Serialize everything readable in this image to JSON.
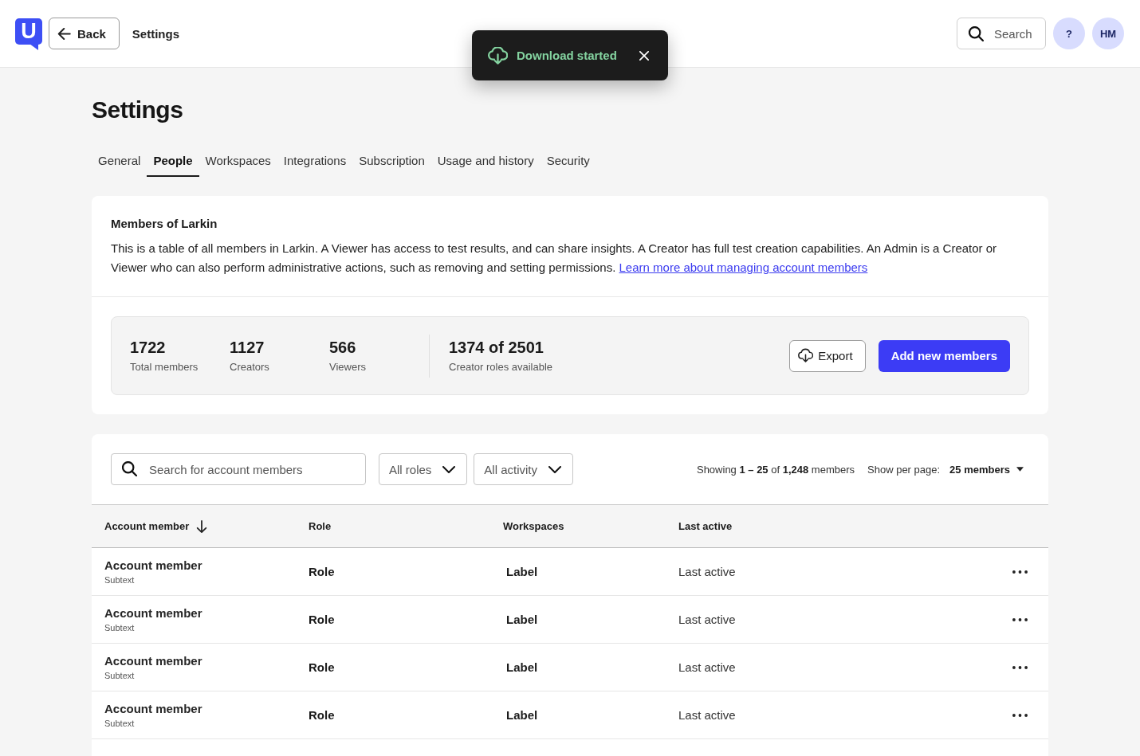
{
  "header": {
    "logo": "U",
    "back": "Back",
    "title": "Settings",
    "search": "Search",
    "help": "?",
    "avatar": "HM"
  },
  "toast": {
    "message": "Download started"
  },
  "page": {
    "title": "Settings"
  },
  "tabs": [
    {
      "label": "General",
      "selected": false
    },
    {
      "label": "People",
      "selected": true
    },
    {
      "label": "Workspaces",
      "selected": false
    },
    {
      "label": "Integrations",
      "selected": false
    },
    {
      "label": "Subscription",
      "selected": false
    },
    {
      "label": "Usage and history",
      "selected": false
    },
    {
      "label": "Security",
      "selected": false
    }
  ],
  "members_card": {
    "title": "Members of Larkin",
    "description": "This is a table of all members in Larkin. A Viewer has access to test results, and can share insights. A Creator has full test creation capabilities. An Admin is a Creator or Viewer who can also perform administrative actions, such as removing and setting permissions.",
    "link": "Learn more about managing account members"
  },
  "stats": {
    "counts": [
      {
        "value": "1722",
        "label": "Total members"
      },
      {
        "value": "1127",
        "label": "Creators"
      },
      {
        "value": "566",
        "label": "Viewers"
      }
    ],
    "capacity": {
      "value": "1374 of 2501",
      "label": "Creator roles available"
    }
  },
  "actions": {
    "export": "Export",
    "add": "Add new members"
  },
  "filters": {
    "search": {
      "placeholder": "Search for account members"
    },
    "roles": "All roles",
    "activity": "All activity"
  },
  "pagination": {
    "showing": "Showing **1 – 25** of **1,248** members",
    "per_page_label": "Show per page:",
    "per_page_value": "25 members"
  },
  "table": {
    "columns": [
      {
        "label": "Account member",
        "sorted": true
      },
      {
        "label": "Role",
        "sorted": false
      },
      {
        "label": "Workspaces",
        "sorted": false
      },
      {
        "label": "Last active",
        "sorted": false
      }
    ],
    "rows": [
      {
        "member": "Account member",
        "subtext": "Subtext",
        "role": "Role",
        "workspaces": "Label",
        "last_active": "Last active"
      },
      {
        "member": "Account member",
        "subtext": "Subtext",
        "role": "Role",
        "workspaces": "Label",
        "last_active": "Last active"
      },
      {
        "member": "Account member",
        "subtext": "Subtext",
        "role": "Role",
        "workspaces": "Label",
        "last_active": "Last active"
      },
      {
        "member": "Account member",
        "subtext": "Subtext",
        "role": "Role",
        "workspaces": "Label",
        "last_active": "Last active"
      }
    ]
  }
}
